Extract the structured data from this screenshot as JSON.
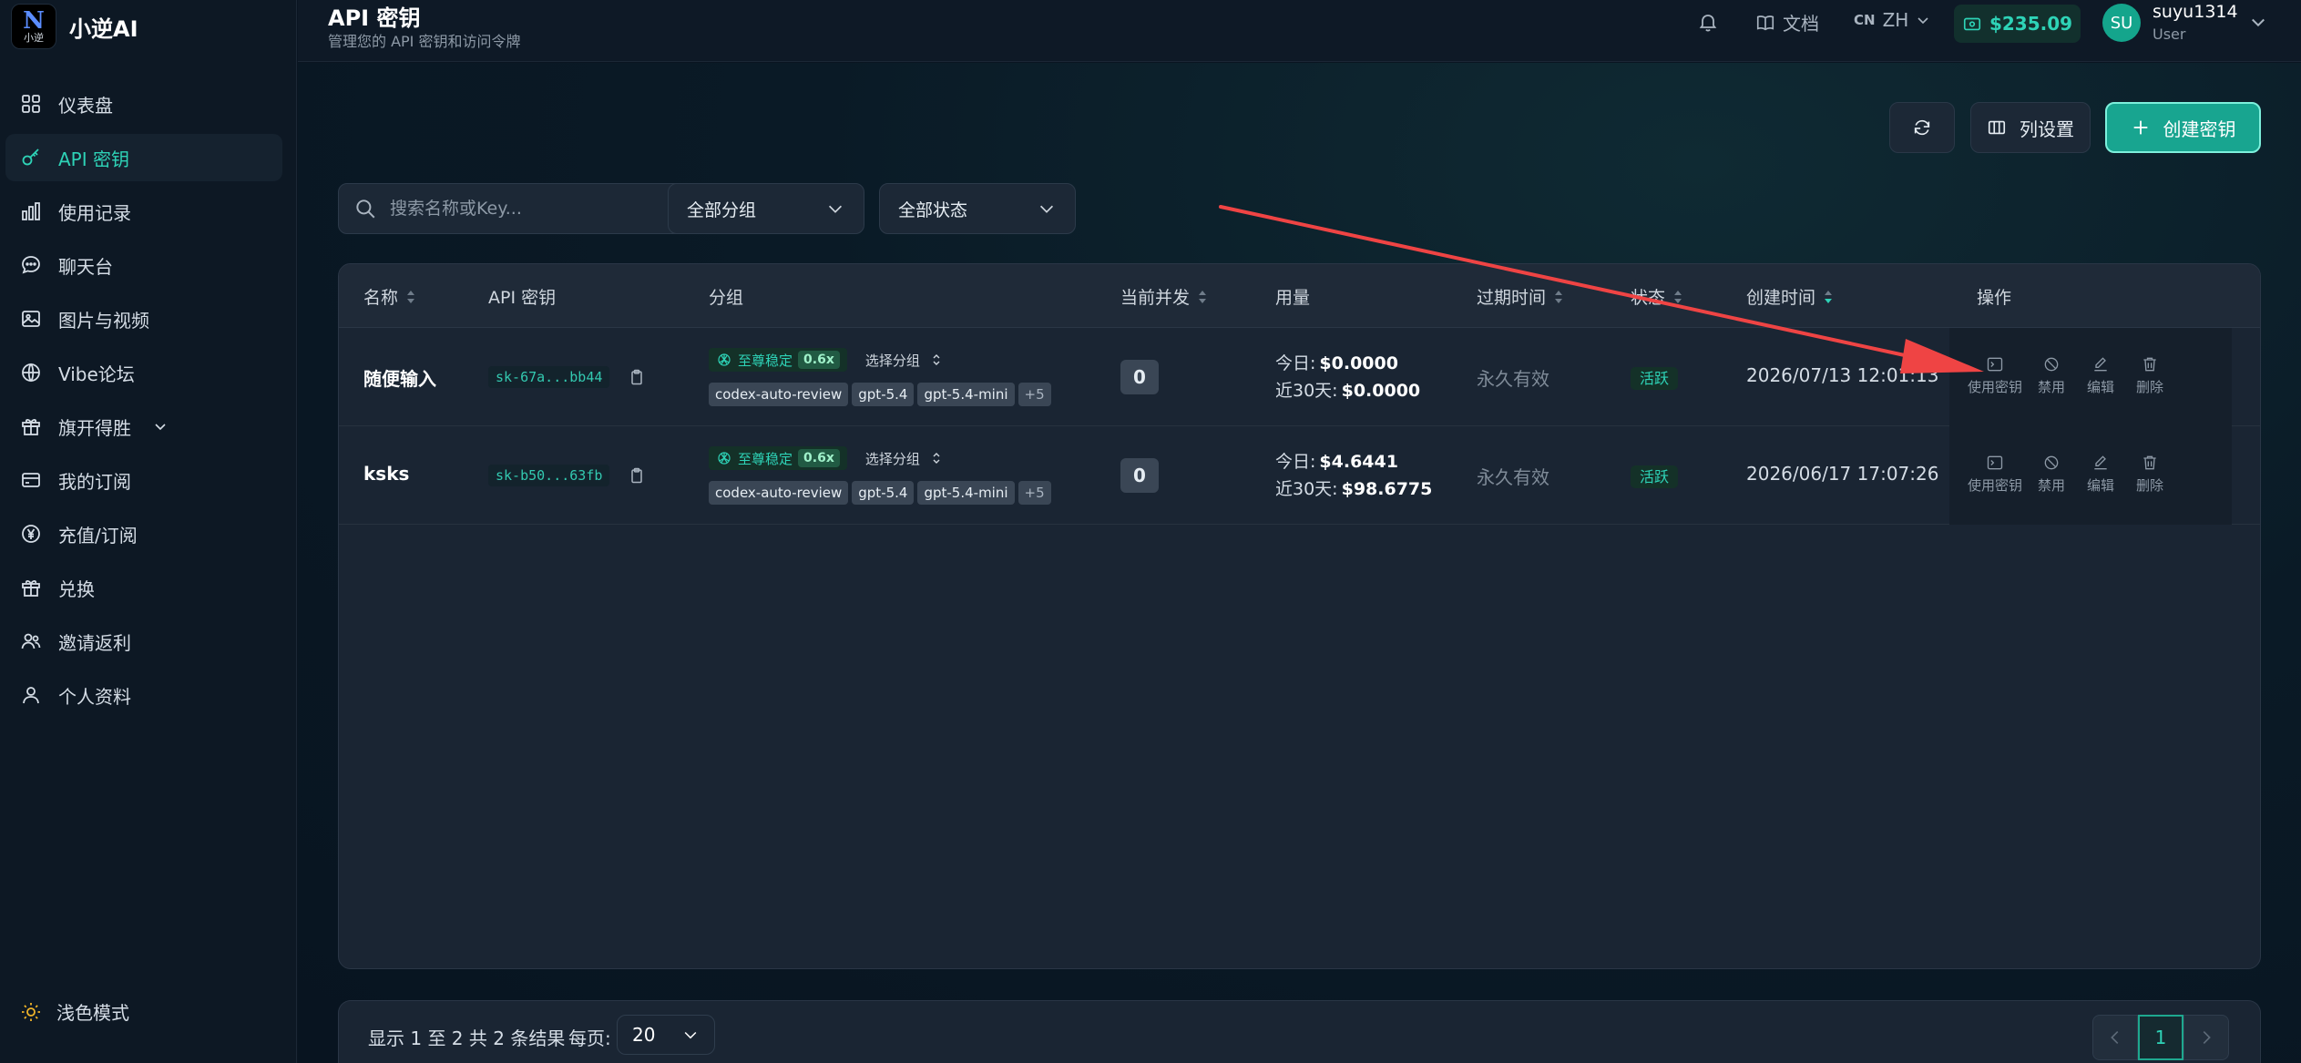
{
  "app": {
    "logo_mark_letter": "N",
    "logo_mark_sub": "小逆",
    "logo_text": "小逆AI"
  },
  "sidebar": {
    "items": [
      {
        "label": "仪表盘",
        "icon": "grid-icon"
      },
      {
        "label": "API 密钥",
        "icon": "key-icon",
        "active": true
      },
      {
        "label": "使用记录",
        "icon": "bar-chart-icon"
      },
      {
        "label": "聊天台",
        "icon": "chat-icon"
      },
      {
        "label": "图片与视频",
        "icon": "image-icon"
      },
      {
        "label": "Vibe论坛",
        "icon": "globe-icon"
      },
      {
        "label": "旗开得胜",
        "icon": "gift-icon",
        "has_submenu": true
      },
      {
        "label": "我的订阅",
        "icon": "card-icon"
      },
      {
        "label": "充值/订阅",
        "icon": "yen-icon"
      },
      {
        "label": "兑换",
        "icon": "gift-box-icon"
      },
      {
        "label": "邀请返利",
        "icon": "users-icon"
      },
      {
        "label": "个人资料",
        "icon": "user-icon"
      }
    ],
    "theme_label": "浅色模式"
  },
  "header": {
    "title": "API 密钥",
    "subtitle": "管理您的 API 密钥和访问令牌",
    "docs_label": "文档",
    "lang_code": "CN",
    "lang_label": "ZH",
    "balance": "$235.09",
    "avatar_initials": "SU",
    "user_name": "suyu1314",
    "user_role": "User"
  },
  "toolbar": {
    "column_settings_label": "列设置",
    "create_key_label": "创建密钥"
  },
  "filters": {
    "search_placeholder": "搜索名称或Key...",
    "group_select": "全部分组",
    "status_select": "全部状态"
  },
  "table": {
    "columns": {
      "name": "名称",
      "key": "API 密钥",
      "group": "分组",
      "concurrency": "当前并发",
      "usage": "用量",
      "expires": "过期时间",
      "status": "状态",
      "created": "创建时间",
      "actions": "操作"
    },
    "rows": [
      {
        "name": "随便输入",
        "key": "sk-67a...bb44",
        "group_name": "至尊稳定",
        "group_ratio": "0.6x",
        "choose_group": "选择分组",
        "models": [
          "codex-auto-review",
          "gpt-5.4",
          "gpt-5.4-mini"
        ],
        "models_more": "+5",
        "concurrency": "0",
        "usage_today_label": "今日:",
        "usage_today": "$0.0000",
        "usage_30d_label": "近30天:",
        "usage_30d": "$0.0000",
        "expires": "永久有效",
        "status": "活跃",
        "created": "2026/07/13 12:01:13"
      },
      {
        "name": "ksks",
        "key": "sk-b50...63fb",
        "group_name": "至尊稳定",
        "group_ratio": "0.6x",
        "choose_group": "选择分组",
        "models": [
          "codex-auto-review",
          "gpt-5.4",
          "gpt-5.4-mini"
        ],
        "models_more": "+5",
        "concurrency": "0",
        "usage_today_label": "今日:",
        "usage_today": "$4.6441",
        "usage_30d_label": "近30天:",
        "usage_30d": "$98.6775",
        "expires": "永久有效",
        "status": "活跃",
        "created": "2026/06/17 17:07:26"
      }
    ],
    "actions": {
      "use": "使用密钥",
      "disable": "禁用",
      "edit": "编辑",
      "delete": "删除"
    }
  },
  "pagination": {
    "summary": "显示 1 至 2 共 2 条结果",
    "per_page_label": "每页:",
    "per_page_value": "20",
    "current_page": "1"
  },
  "colors": {
    "accent": "#2ed3b7",
    "annotation_arrow": "#ef4444"
  }
}
